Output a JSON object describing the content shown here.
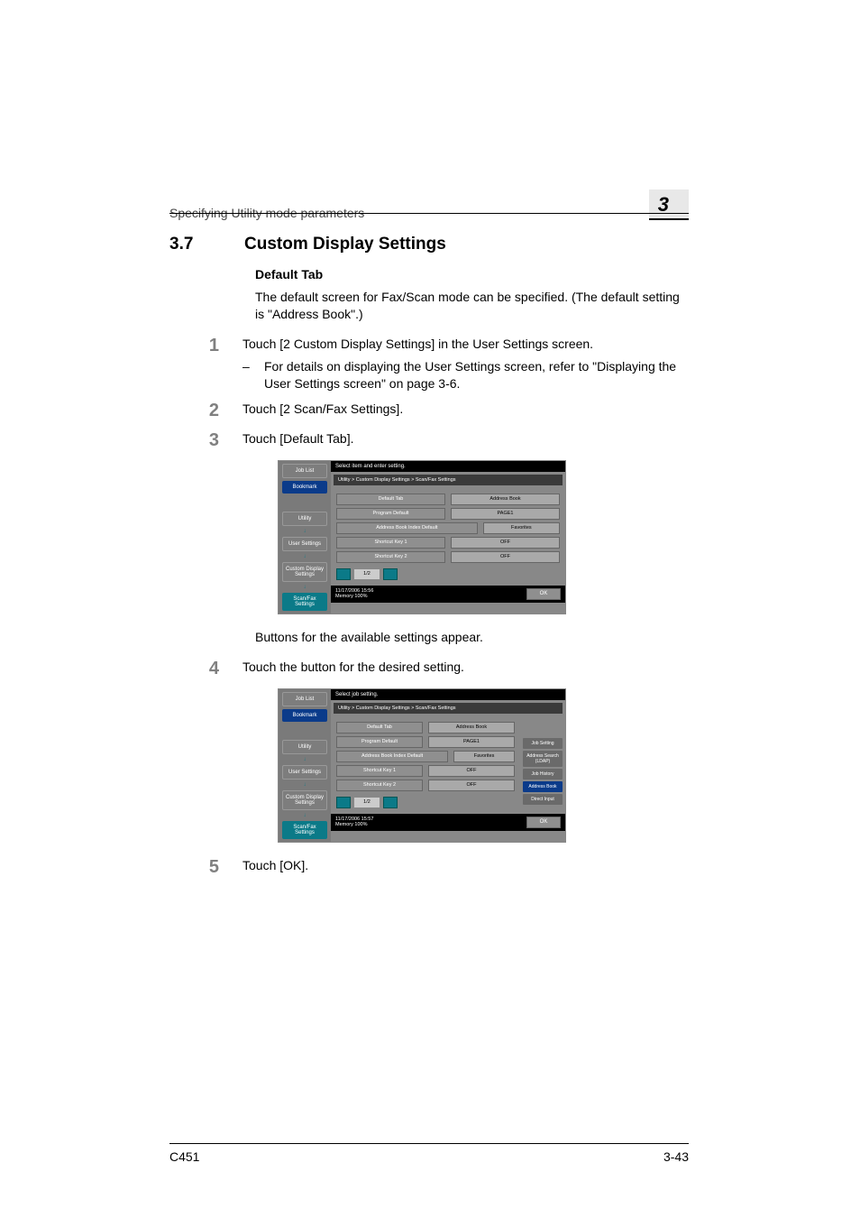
{
  "header": {
    "running": "Specifying Utility mode parameters",
    "chapter_number": "3"
  },
  "section": {
    "number": "3.7",
    "title": "Custom Display Settings"
  },
  "subheading": "Default Tab",
  "intro": "The default screen for Fax/Scan mode can be specified. (The default setting is \"Address Book\".)",
  "steps": {
    "s1": {
      "num": "1",
      "text": "Touch [2 Custom Display Settings] in the User Settings screen.",
      "sub": {
        "dash": "–",
        "text": "For details on displaying the User Settings screen, refer to \"Displaying the User Settings screen\" on page 3-6."
      }
    },
    "s2": {
      "num": "2",
      "text": "Touch [2 Scan/Fax Settings]."
    },
    "s3": {
      "num": "3",
      "text": "Touch [Default Tab]."
    },
    "after3": "Buttons for the available settings appear.",
    "s4": {
      "num": "4",
      "text": "Touch the button for the desired setting."
    },
    "s5": {
      "num": "5",
      "text": "Touch [OK]."
    }
  },
  "screenshot": {
    "msg1": "Select item and enter setting.",
    "msg2": "Select job setting.",
    "crumb": "Utility > Custom Display Settings > Scan/Fax Settings",
    "side": {
      "joblist": "Job List",
      "bookmark": "Bookmark",
      "utility": "Utility",
      "usersettings": "User Settings",
      "custom": "Custom Display\nSettings",
      "scanfax": "Scan/Fax\nSettings"
    },
    "rows": {
      "r1": {
        "label": "Default Tab",
        "value": "Address Book"
      },
      "r2": {
        "label": "Program Default",
        "value": "PAGE1"
      },
      "r3": {
        "label": "Address Book Index Default",
        "value": "Favorites"
      },
      "r4": {
        "label": "Shortcut Key 1",
        "value": "OFF"
      },
      "r5": {
        "label": "Shortcut Key 2",
        "value": "OFF"
      }
    },
    "pager": "1/2",
    "footer": {
      "date1": "11/17/2006   15:56",
      "date2": "11/17/2006   15:57",
      "mem": "Memory      100%",
      "ok": "OK"
    },
    "right": {
      "jobsetting": "Job Setting",
      "addrsearch": "Address Search\n(LDAP)",
      "jobhistory": "Job History",
      "addrbook": "Address Book",
      "direct": "Direct Input"
    }
  },
  "footer": {
    "left": "C451",
    "right": "3-43"
  }
}
